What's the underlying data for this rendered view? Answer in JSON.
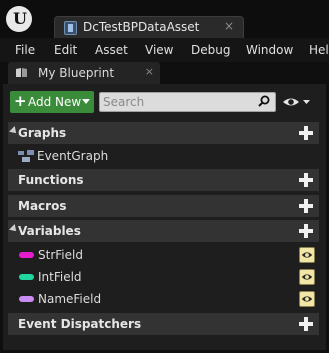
{
  "app": {
    "logo_icon": "unreal-engine-logo-icon"
  },
  "document_tab": {
    "title": "DcTestBPDataAsset",
    "close_glyph": "×",
    "icon": "blueprint-asset-icon"
  },
  "menu": {
    "items": [
      "File",
      "Edit",
      "Asset",
      "View",
      "Debug",
      "Window",
      "Help"
    ]
  },
  "panel_tab": {
    "label": "My Blueprint",
    "close_glyph": "×",
    "icon": "book-icon"
  },
  "toolbar": {
    "add_new_label": "Add New",
    "add_new_plus": "+",
    "search_placeholder": "Search",
    "view_options_icon": "eye-icon"
  },
  "sections": {
    "graphs": {
      "title": "Graphs",
      "items": [
        {
          "label": "EventGraph",
          "icon": "event-graph-icon"
        }
      ]
    },
    "functions": {
      "title": "Functions"
    },
    "macros": {
      "title": "Macros"
    },
    "variables": {
      "title": "Variables",
      "items": [
        {
          "label": "StrField",
          "type_color": "#e81ccf"
        },
        {
          "label": "IntField",
          "type_color": "#1fd6a0"
        },
        {
          "label": "NameField",
          "type_color": "#c98cf2"
        }
      ]
    },
    "event_dispatchers": {
      "title": "Event Dispatchers"
    }
  },
  "colors": {
    "accent_green": "#3a8b3a",
    "section_header": "#333333",
    "panel_bg": "#1e1e1e"
  }
}
